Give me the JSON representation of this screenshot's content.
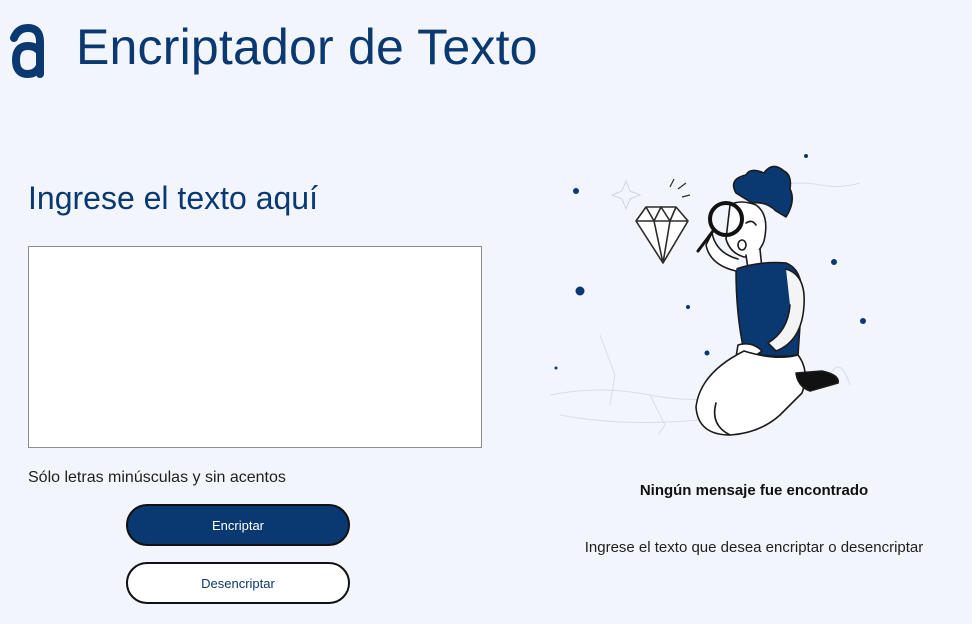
{
  "header": {
    "logo_icon": "alura-a-logo-icon",
    "title": "Encriptador de Texto"
  },
  "input_panel": {
    "heading": "Ingrese el texto aquí",
    "textarea_value": "",
    "hint": "Sólo letras minúsculas y sin acentos",
    "encrypt_label": "Encriptar",
    "decrypt_label": "Desencriptar"
  },
  "output_panel": {
    "illustration": "person-with-magnifying-glass-and-diamond-illustration",
    "empty_title": "Ningún mensaje fue encontrado",
    "empty_description": "Ingrese el texto que desea encriptar o desencriptar"
  },
  "colors": {
    "background": "#f2f5fc",
    "primary": "#0a3871",
    "text": "#1f1f1f"
  }
}
